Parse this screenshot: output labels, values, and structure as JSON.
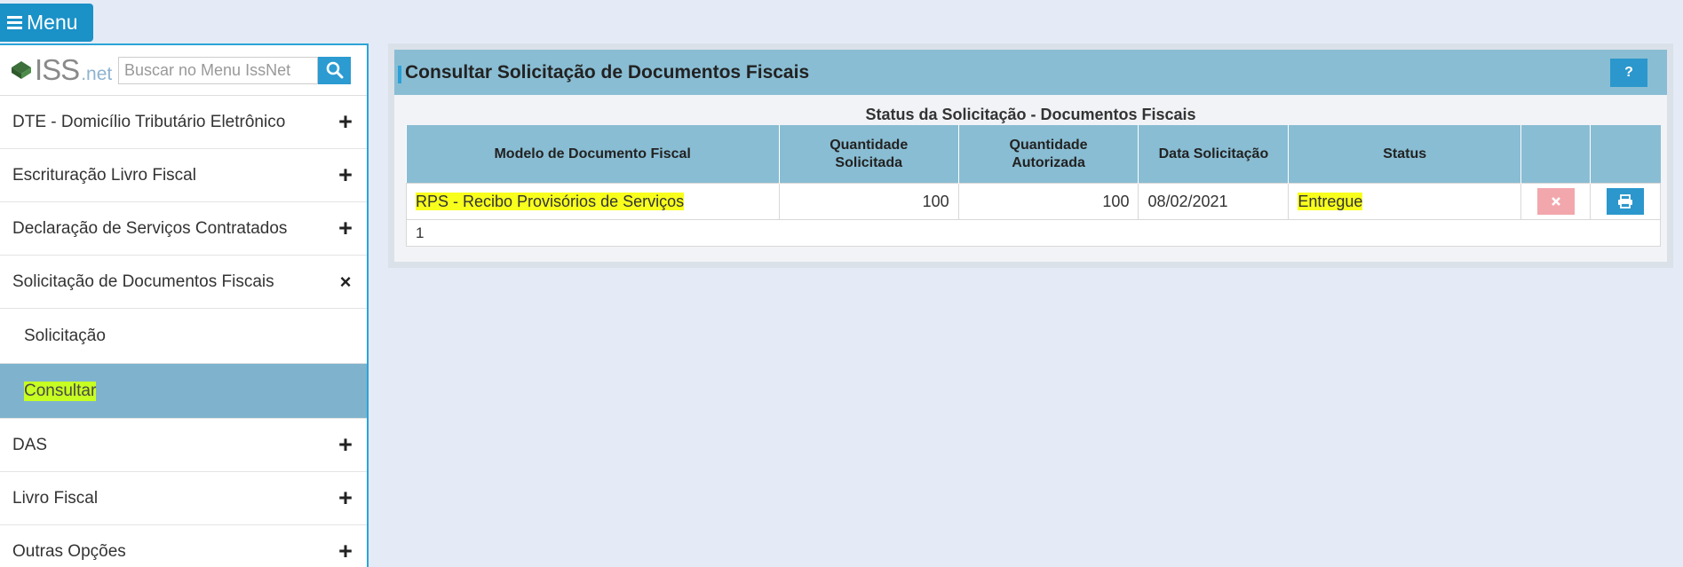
{
  "menu_button": {
    "label": "Menu"
  },
  "sidebar": {
    "logo": {
      "iss": "ISS",
      "net": ".net"
    },
    "search": {
      "placeholder": "Buscar no Menu IssNet"
    },
    "items": [
      {
        "label": "DTE - Domicílio Tributário Eletrônico",
        "sign": "+"
      },
      {
        "label": "Escrituração Livro Fiscal",
        "sign": "+"
      },
      {
        "label": "Declaração de Serviços Contratados",
        "sign": "+"
      },
      {
        "label": "Solicitação de Documentos Fiscais",
        "sign": "×"
      }
    ],
    "subitems": [
      {
        "label": "Solicitação"
      },
      {
        "label": "Consultar",
        "active": true
      }
    ],
    "items_after": [
      {
        "label": "DAS",
        "sign": "+"
      },
      {
        "label": "Livro Fiscal",
        "sign": "+"
      },
      {
        "label": "Outras Opções",
        "sign": "+"
      }
    ]
  },
  "panel": {
    "title": "Consultar Solicitação de Documentos Fiscais",
    "help_label": "?",
    "caption": "Status da Solicitação - Documentos Fiscais",
    "table": {
      "headers": [
        "Modelo de Documento Fiscal",
        "Quantidade Solicitada",
        "Quantidade Autorizada",
        "Data Solicitação",
        "Status"
      ],
      "rows": [
        {
          "modelo": "RPS - Recibo Provisórios de Serviços",
          "qtd_solicitada": "100",
          "qtd_autorizada": "100",
          "data": "08/02/2021",
          "status": "Entregue"
        }
      ],
      "pager": "1"
    }
  },
  "colors": {
    "accent": "#2b97cc",
    "header_bg": "#89bdd3",
    "highlight": "#f8ff1c",
    "delete_button": "#f2a7ad"
  }
}
